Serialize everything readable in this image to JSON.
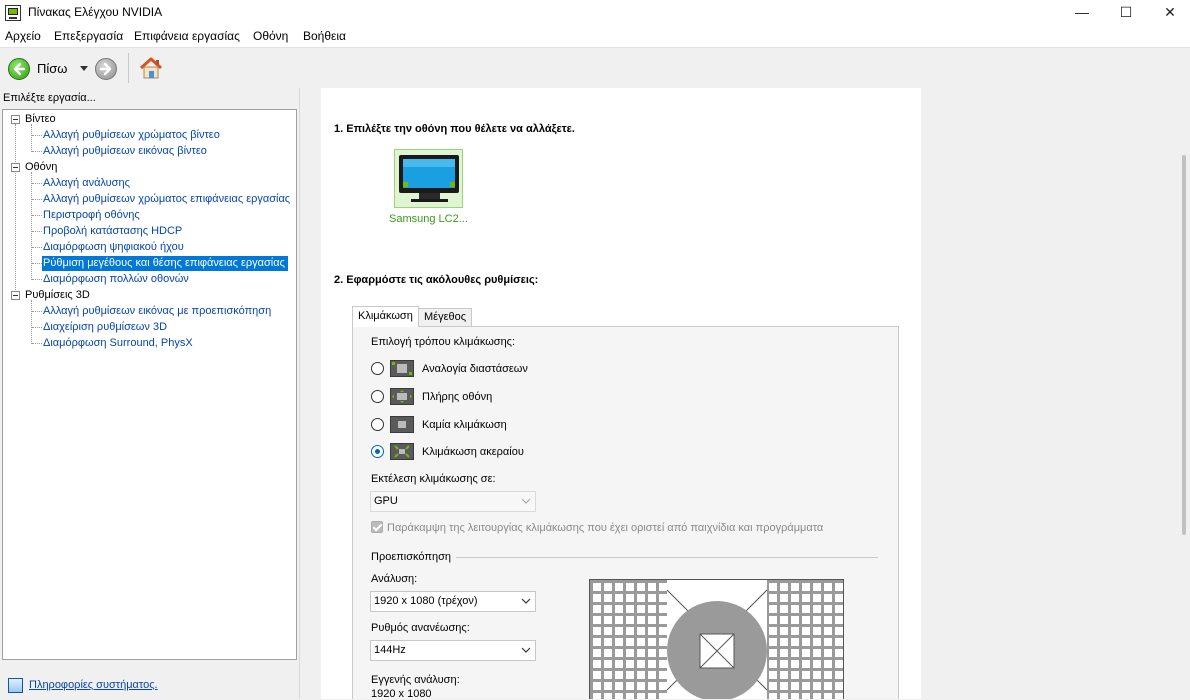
{
  "window": {
    "title": "Πίνακας Ελέγχου NVIDIA",
    "controls": {
      "minimize": "—",
      "maximize": "☐",
      "close": "✕"
    }
  },
  "menu": [
    "Αρχείο",
    "Επεξεργασία",
    "Επιφάνεια εργασίας",
    "Οθόνη",
    "Βοήθεια"
  ],
  "toolbar": {
    "back_label": "Πίσω"
  },
  "sidebar": {
    "header": "Επιλέξτε εργασία...",
    "categories": [
      {
        "label": "Βίντεο",
        "items": [
          "Αλλαγή ρυθμίσεων χρώματος βίντεο",
          "Αλλαγή ρυθμίσεων εικόνας βίντεο"
        ]
      },
      {
        "label": "Οθόνη",
        "items": [
          "Αλλαγή ανάλυσης",
          "Αλλαγή ρυθμίσεων χρώματος επιφάνειας εργασίας",
          "Περιστροφή οθόνης",
          "Προβολή κατάστασης HDCP",
          "Διαμόρφωση ψηφιακού ήχου",
          "Ρύθμιση μεγέθους και θέσης επιφάνειας εργασίας",
          "Διαμόρφωση πολλών οθονών"
        ]
      },
      {
        "label": "Ρυθμίσεις 3D",
        "items": [
          "Αλλαγή ρυθμίσεων εικόνας με προεπισκόπηση",
          "Διαχείριση ρυθμίσεων 3D",
          "Διαμόρφωση Surround, PhysX"
        ]
      }
    ],
    "selected": "Ρύθμιση μεγέθους και θέσης επιφάνειας εργασίας",
    "system_info": "Πληροφορίες συστήματος."
  },
  "main": {
    "step1_title": "1. Επιλέξτε την οθόνη που θέλετε να αλλάξετε.",
    "display_name": "Samsung LC2...",
    "step2_title": "2. Εφαρμόστε τις ακόλουθες ρυθμίσεις:",
    "tabs": [
      "Κλιμάκωση",
      "Μέγεθος"
    ],
    "active_tab": "Κλιμάκωση",
    "scaling_mode_label": "Επιλογή τρόπου κλιμάκωσης:",
    "scaling_options": [
      {
        "label": "Αναλογία διαστάσεων",
        "selected": false
      },
      {
        "label": "Πλήρης οθόνη",
        "selected": false
      },
      {
        "label": "Καμία κλιμάκωση",
        "selected": false
      },
      {
        "label": "Κλιμάκωση ακεραίου",
        "selected": true
      }
    ],
    "perform_on_label": "Εκτέλεση κλιμάκωσης σε:",
    "perform_on_value": "GPU",
    "override_label": "Παράκαμψη της λειτουργίας κλιμάκωσης που έχει οριστεί από παιχνίδια και προγράμματα",
    "override_checked": true,
    "preview_label": "Προεπισκόπηση",
    "resolution_label": "Ανάλυση:",
    "resolution_value": "1920 x 1080 (τρέχον)",
    "refresh_label": "Ρυθμός ανανέωσης:",
    "refresh_value": "144Hz",
    "native_label": "Εγγενής ανάλυση:",
    "native_value": "1920 x 1080"
  },
  "colors": {
    "accent": "#0078d7",
    "nvidia_green": "#76b900",
    "link": "#0645ad"
  }
}
